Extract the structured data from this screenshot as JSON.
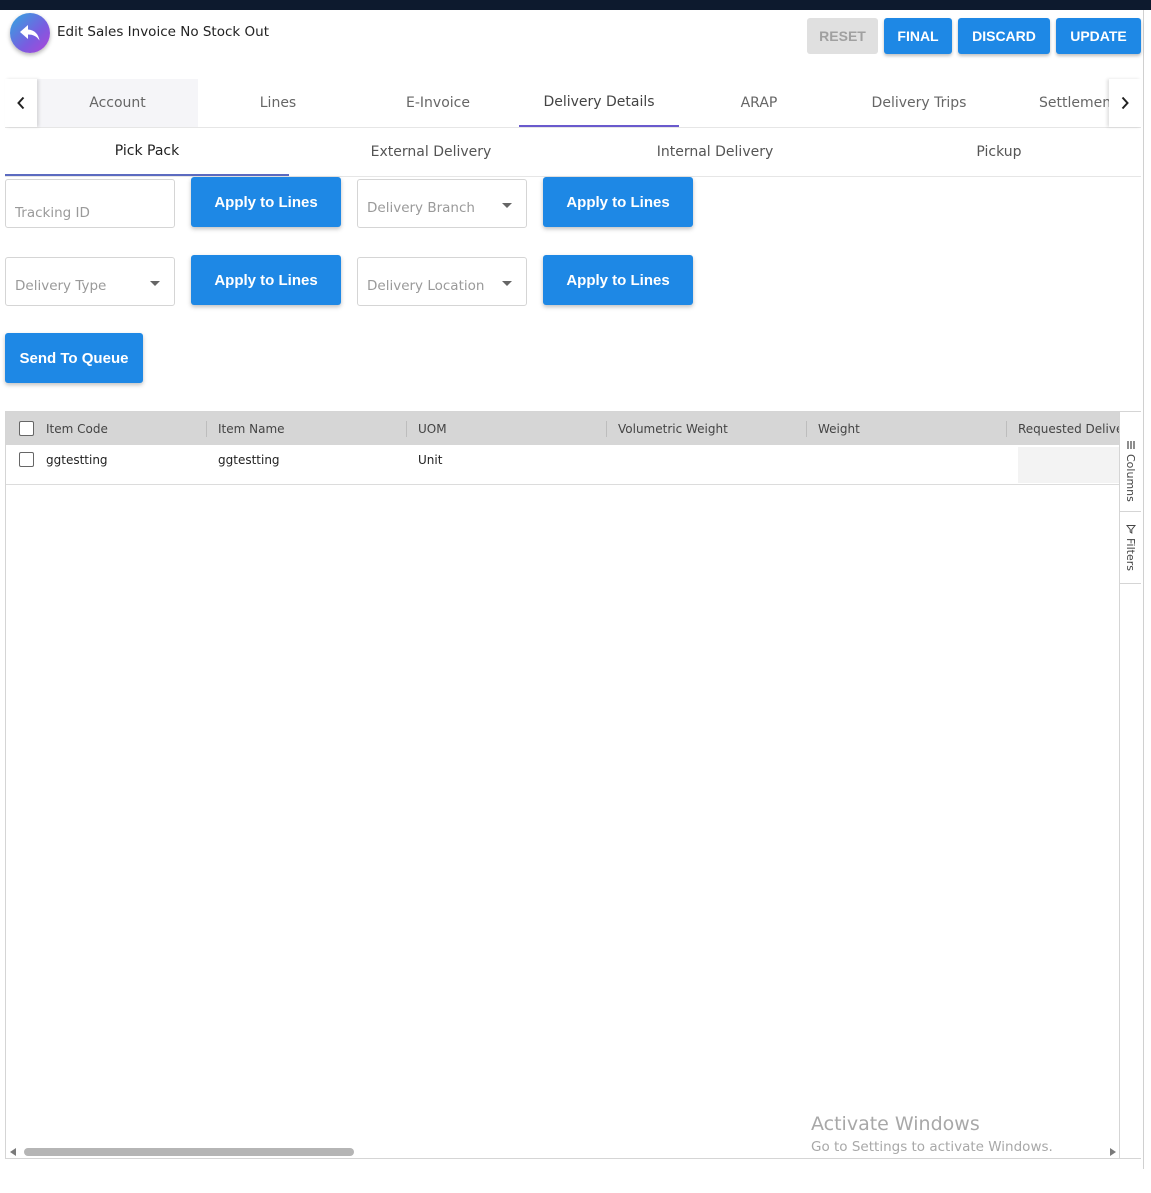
{
  "header": {
    "title": "Edit Sales Invoice No Stock Out",
    "buttons": {
      "reset": "RESET",
      "final": "FINAL",
      "discard": "DISCARD",
      "update": "UPDATE"
    }
  },
  "main_tabs": [
    {
      "label": "Account"
    },
    {
      "label": "Lines"
    },
    {
      "label": "E-Invoice"
    },
    {
      "label": "Delivery Details",
      "active": true
    },
    {
      "label": "ARAP"
    },
    {
      "label": "Delivery Trips"
    },
    {
      "label": "Settlemen"
    }
  ],
  "sub_tabs": [
    {
      "label": "Pick Pack",
      "active": true
    },
    {
      "label": "External Delivery"
    },
    {
      "label": "Internal Delivery"
    },
    {
      "label": "Pickup"
    }
  ],
  "form": {
    "tracking_id": {
      "placeholder": "Tracking ID",
      "value": ""
    },
    "delivery_branch": {
      "placeholder": "Delivery Branch"
    },
    "delivery_type": {
      "placeholder": "Delivery Type"
    },
    "delivery_location": {
      "placeholder": "Delivery Location"
    },
    "apply_label": "Apply to Lines",
    "send_to_queue": "Send To Queue"
  },
  "grid": {
    "columns": [
      "Item Code",
      "Item Name",
      "UOM",
      "Volumetric Weight",
      "Weight",
      "Requested Delivery"
    ],
    "rows": [
      {
        "item_code": "ggtestting",
        "item_name": "ggtestting",
        "uom": "Unit",
        "volumetric_weight": "",
        "weight": ""
      }
    ],
    "side_panel": {
      "columns": "Columns",
      "filters": "Filters"
    }
  },
  "watermark": {
    "line1": "Activate Windows",
    "line2": "Go to Settings to activate Windows."
  }
}
